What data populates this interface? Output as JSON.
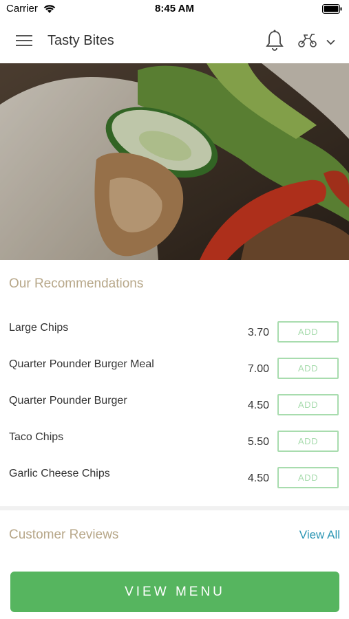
{
  "status_bar": {
    "carrier": "Carrier",
    "time": "8:45 AM"
  },
  "header": {
    "title": "Tasty Bites",
    "icons": [
      "menu-icon",
      "bell-icon",
      "delivery-icon",
      "chevron-down-icon"
    ]
  },
  "recommendations": {
    "title": "Our Recommendations",
    "items": [
      {
        "name": "Large Chips",
        "price": "3.70",
        "button": "ADD"
      },
      {
        "name": "Quarter Pounder Burger Meal",
        "price": "7.00",
        "button": "ADD"
      },
      {
        "name": "Quarter Pounder Burger",
        "price": "4.50",
        "button": "ADD"
      },
      {
        "name": "Taco Chips",
        "price": "5.50",
        "button": "ADD"
      },
      {
        "name": "Garlic Cheese Chips",
        "price": "4.50",
        "button": "ADD"
      }
    ]
  },
  "reviews": {
    "title": "Customer Reviews",
    "view_all": "View All"
  },
  "cta": {
    "label": "VIEW MENU"
  },
  "colors": {
    "accent_green": "#56b55f",
    "section_title": "#b7a789",
    "link": "#2d96b4"
  }
}
